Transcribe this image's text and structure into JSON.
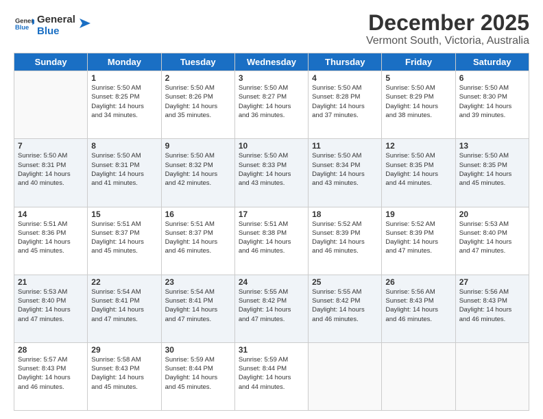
{
  "logo": {
    "line1": "General",
    "line2": "Blue"
  },
  "title": "December 2025",
  "subtitle": "Vermont South, Victoria, Australia",
  "weekdays": [
    "Sunday",
    "Monday",
    "Tuesday",
    "Wednesday",
    "Thursday",
    "Friday",
    "Saturday"
  ],
  "weeks": [
    [
      {
        "day": "",
        "empty": true
      },
      {
        "day": "1",
        "sunrise": "5:50 AM",
        "sunset": "8:25 PM",
        "daylight": "14 hours and 34 minutes."
      },
      {
        "day": "2",
        "sunrise": "5:50 AM",
        "sunset": "8:26 PM",
        "daylight": "14 hours and 35 minutes."
      },
      {
        "day": "3",
        "sunrise": "5:50 AM",
        "sunset": "8:27 PM",
        "daylight": "14 hours and 36 minutes."
      },
      {
        "day": "4",
        "sunrise": "5:50 AM",
        "sunset": "8:28 PM",
        "daylight": "14 hours and 37 minutes."
      },
      {
        "day": "5",
        "sunrise": "5:50 AM",
        "sunset": "8:29 PM",
        "daylight": "14 hours and 38 minutes."
      },
      {
        "day": "6",
        "sunrise": "5:50 AM",
        "sunset": "8:30 PM",
        "daylight": "14 hours and 39 minutes."
      }
    ],
    [
      {
        "day": "7",
        "sunrise": "5:50 AM",
        "sunset": "8:31 PM",
        "daylight": "14 hours and 40 minutes."
      },
      {
        "day": "8",
        "sunrise": "5:50 AM",
        "sunset": "8:31 PM",
        "daylight": "14 hours and 41 minutes."
      },
      {
        "day": "9",
        "sunrise": "5:50 AM",
        "sunset": "8:32 PM",
        "daylight": "14 hours and 42 minutes."
      },
      {
        "day": "10",
        "sunrise": "5:50 AM",
        "sunset": "8:33 PM",
        "daylight": "14 hours and 43 minutes."
      },
      {
        "day": "11",
        "sunrise": "5:50 AM",
        "sunset": "8:34 PM",
        "daylight": "14 hours and 43 minutes."
      },
      {
        "day": "12",
        "sunrise": "5:50 AM",
        "sunset": "8:35 PM",
        "daylight": "14 hours and 44 minutes."
      },
      {
        "day": "13",
        "sunrise": "5:50 AM",
        "sunset": "8:35 PM",
        "daylight": "14 hours and 45 minutes."
      }
    ],
    [
      {
        "day": "14",
        "sunrise": "5:51 AM",
        "sunset": "8:36 PM",
        "daylight": "14 hours and 45 minutes."
      },
      {
        "day": "15",
        "sunrise": "5:51 AM",
        "sunset": "8:37 PM",
        "daylight": "14 hours and 45 minutes."
      },
      {
        "day": "16",
        "sunrise": "5:51 AM",
        "sunset": "8:37 PM",
        "daylight": "14 hours and 46 minutes."
      },
      {
        "day": "17",
        "sunrise": "5:51 AM",
        "sunset": "8:38 PM",
        "daylight": "14 hours and 46 minutes."
      },
      {
        "day": "18",
        "sunrise": "5:52 AM",
        "sunset": "8:39 PM",
        "daylight": "14 hours and 46 minutes."
      },
      {
        "day": "19",
        "sunrise": "5:52 AM",
        "sunset": "8:39 PM",
        "daylight": "14 hours and 47 minutes."
      },
      {
        "day": "20",
        "sunrise": "5:53 AM",
        "sunset": "8:40 PM",
        "daylight": "14 hours and 47 minutes."
      }
    ],
    [
      {
        "day": "21",
        "sunrise": "5:53 AM",
        "sunset": "8:40 PM",
        "daylight": "14 hours and 47 minutes."
      },
      {
        "day": "22",
        "sunrise": "5:54 AM",
        "sunset": "8:41 PM",
        "daylight": "14 hours and 47 minutes."
      },
      {
        "day": "23",
        "sunrise": "5:54 AM",
        "sunset": "8:41 PM",
        "daylight": "14 hours and 47 minutes."
      },
      {
        "day": "24",
        "sunrise": "5:55 AM",
        "sunset": "8:42 PM",
        "daylight": "14 hours and 47 minutes."
      },
      {
        "day": "25",
        "sunrise": "5:55 AM",
        "sunset": "8:42 PM",
        "daylight": "14 hours and 46 minutes."
      },
      {
        "day": "26",
        "sunrise": "5:56 AM",
        "sunset": "8:43 PM",
        "daylight": "14 hours and 46 minutes."
      },
      {
        "day": "27",
        "sunrise": "5:56 AM",
        "sunset": "8:43 PM",
        "daylight": "14 hours and 46 minutes."
      }
    ],
    [
      {
        "day": "28",
        "sunrise": "5:57 AM",
        "sunset": "8:43 PM",
        "daylight": "14 hours and 46 minutes."
      },
      {
        "day": "29",
        "sunrise": "5:58 AM",
        "sunset": "8:43 PM",
        "daylight": "14 hours and 45 minutes."
      },
      {
        "day": "30",
        "sunrise": "5:59 AM",
        "sunset": "8:44 PM",
        "daylight": "14 hours and 45 minutes."
      },
      {
        "day": "31",
        "sunrise": "5:59 AM",
        "sunset": "8:44 PM",
        "daylight": "14 hours and 44 minutes."
      },
      {
        "day": "",
        "empty": true
      },
      {
        "day": "",
        "empty": true
      },
      {
        "day": "",
        "empty": true
      }
    ]
  ]
}
